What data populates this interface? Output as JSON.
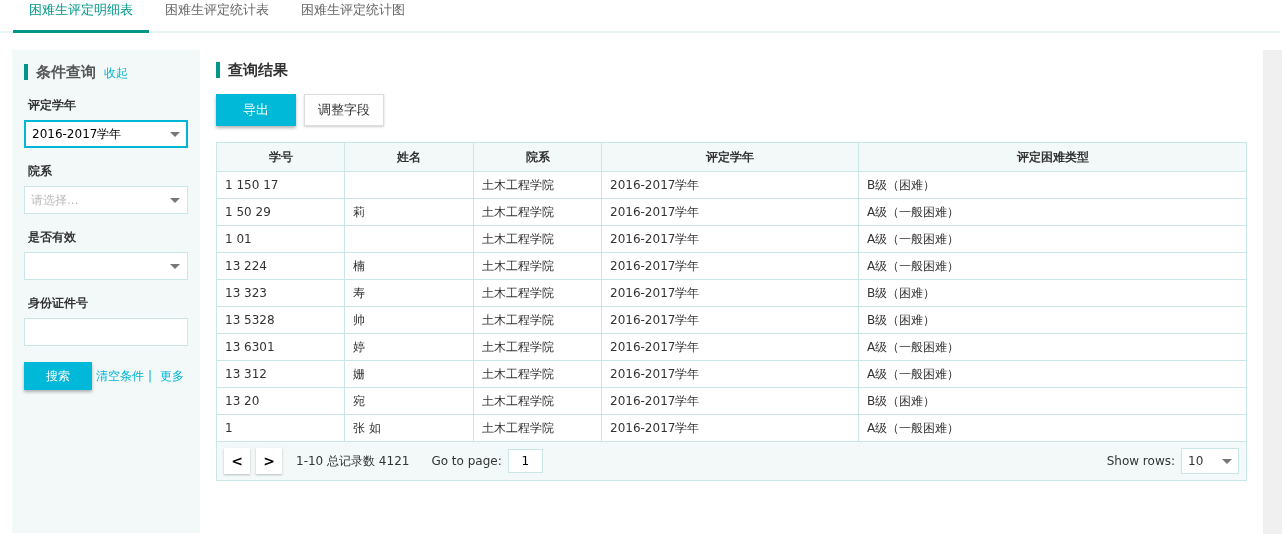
{
  "tabs": [
    {
      "label": "困难生评定明细表",
      "selected": true
    },
    {
      "label": "困难生评定统计表",
      "selected": false
    },
    {
      "label": "困难生评定统计图",
      "selected": false
    }
  ],
  "filter": {
    "title": "条件查询",
    "collapse_link": "收起",
    "fields": [
      {
        "label": "评定学年",
        "kind": "select",
        "value": "2016-2017学年",
        "focused": true
      },
      {
        "label": "院系",
        "kind": "select",
        "placeholder": "请选择...",
        "focused": false
      },
      {
        "label": "是否有效",
        "kind": "select",
        "focused": false
      },
      {
        "label": "身份证件号",
        "kind": "text",
        "focused": false
      }
    ],
    "search_button": "搜索",
    "clear_link": "清空条件",
    "separator": "|",
    "more_link": "更多"
  },
  "results": {
    "title": "查询结果",
    "buttons": [
      {
        "label": "导出",
        "primary": true
      },
      {
        "label": "调整字段",
        "primary": false
      }
    ],
    "table": {
      "columns": [
        "学号",
        "姓名",
        "院系",
        "评定学年",
        "评定困难类型"
      ],
      "rows": [
        [
          "1 150 17",
          "",
          "土木工程学院",
          "2016-2017学年",
          "B级（困难）"
        ],
        [
          "1 50 29",
          "莉",
          "土木工程学院",
          "2016-2017学年",
          "A级（一般困难）"
        ],
        [
          "1 01",
          "",
          "土木工程学院",
          "2016-2017学年",
          "A级（一般困难）"
        ],
        [
          "13 224",
          "楠",
          "土木工程学院",
          "2016-2017学年",
          "A级（一般困难）"
        ],
        [
          "13 323",
          "寿",
          "土木工程学院",
          "2016-2017学年",
          "B级（困难）"
        ],
        [
          "13 5328",
          "帅",
          "土木工程学院",
          "2016-2017学年",
          "B级（困难）"
        ],
        [
          "13 6301",
          "婷",
          "土木工程学院",
          "2016-2017学年",
          "A级（一般困难）"
        ],
        [
          "13 312",
          "姗",
          "土木工程学院",
          "2016-2017学年",
          "A级（一般困难）"
        ],
        [
          "13 20",
          "宛",
          "土木工程学院",
          "2016-2017学年",
          "B级（困难）"
        ],
        [
          "1",
          "张 如",
          "土木工程学院",
          "2016-2017学年",
          "A级（一般困难）"
        ]
      ]
    },
    "pager": {
      "prev": "<",
      "next": ">",
      "summary": "1-10 总记录数 4121",
      "goto_label": "Go to page:",
      "page": "1",
      "rows_label": "Show rows:",
      "rows_value": "10"
    }
  }
}
